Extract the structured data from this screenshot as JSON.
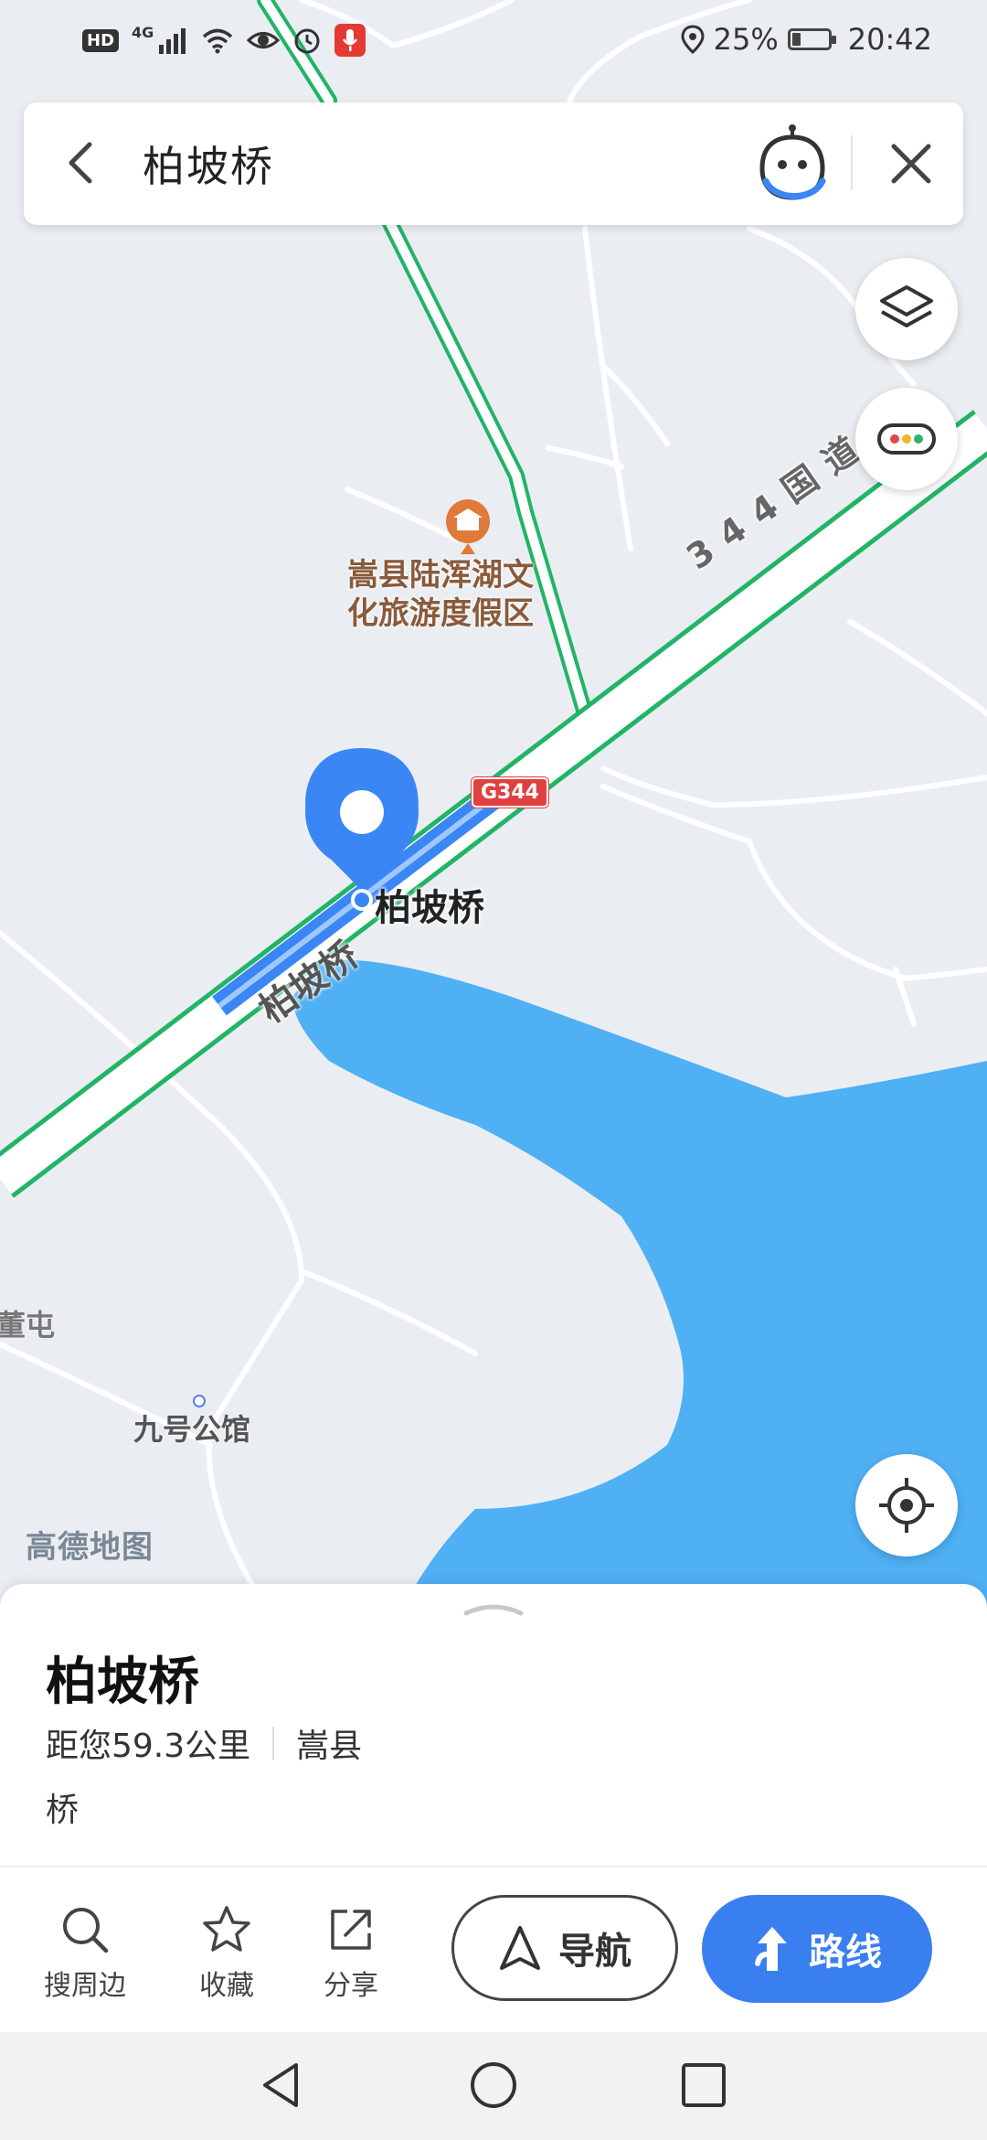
{
  "status_bar": {
    "hd": "HD",
    "network": "4G",
    "battery_percent": "25%",
    "battery_level": 0.25,
    "time": "20:42"
  },
  "search": {
    "query": "柏坡桥"
  },
  "map": {
    "scenic_area_line1": "嵩县陆浑湖文",
    "scenic_area_line2": "化旅游度假区",
    "road_name": "344国道",
    "road_badge": "G344",
    "bridge_road_label": "柏坡桥",
    "poi_label": "柏坡桥",
    "village_label": "董屯",
    "building_label": "九号公馆",
    "brand": "高德地图",
    "water_color": "#4fb0f4",
    "road_color": "#22b466",
    "pin_color": "#3b86f5"
  },
  "place": {
    "name": "柏坡桥",
    "distance": "距您59.3公里",
    "region": "嵩县",
    "type": "桥"
  },
  "actions": {
    "nearby": "搜周边",
    "favorite": "收藏",
    "share": "分享",
    "navigate": "导航",
    "route": "路线"
  },
  "accent_color": "#3a7ff0"
}
